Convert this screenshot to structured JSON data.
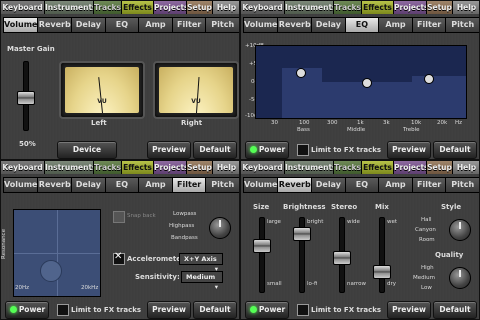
{
  "nav_tabs": [
    "Keyboard",
    "Instruments",
    "Tracks",
    "Effects",
    "Projects",
    "Setup",
    "Help"
  ],
  "panels": {
    "volume": {
      "fx_tabs": [
        "Volume",
        "Reverb",
        "Delay",
        "EQ",
        "Amp",
        "Filter",
        "Pitch"
      ],
      "active": "Volume",
      "master_gain_label": "Master Gain",
      "gain_value": "50%",
      "meter_text": "VU",
      "meter_left": "Left",
      "meter_right": "Right",
      "device_volume": "Device Volume",
      "preview": "Preview",
      "default": "Default"
    },
    "eq": {
      "fx_tabs": [
        "Volume",
        "Reverb",
        "Delay",
        "EQ",
        "Amp",
        "Filter",
        "Pitch"
      ],
      "active": "EQ",
      "db_labels": [
        "+10dB",
        "+5dB",
        "0dB",
        "-5dB",
        "-10dB"
      ],
      "freq_labels": [
        "30",
        "100",
        "300",
        "1k",
        "3k",
        "10k",
        "20k",
        "Hz"
      ],
      "band_labels": [
        "Bass",
        "Middle",
        "Treble"
      ],
      "power": "Power",
      "limit": "Limit to FX tracks",
      "preview": "Preview",
      "default": "Default"
    },
    "filter": {
      "fx_tabs": [
        "Volume",
        "Reverb",
        "Delay",
        "EQ",
        "Amp",
        "Filter",
        "Pitch"
      ],
      "active": "Filter",
      "resonance_label": "Resonance",
      "x_min": "20Hz",
      "x_max": "20kHz",
      "snap_back": "Snap back",
      "modes": [
        "Lowpass",
        "Highpass",
        "Bandpass"
      ],
      "accelerometer": "Accelerometer:",
      "accel_value": "X+Y Axis",
      "sensitivity": "Sensitivity:",
      "sensitivity_value": "Medium",
      "power": "Power",
      "limit": "Limit to FX tracks",
      "preview": "Preview",
      "default": "Default"
    },
    "reverb": {
      "fx_tabs": [
        "Volume",
        "Reverb",
        "Delay",
        "EQ",
        "Amp",
        "Filter",
        "Pitch"
      ],
      "active": "Reverb",
      "size": "Size",
      "brightness": "Brightness",
      "stereo": "Stereo",
      "mix": "Mix",
      "style": "Style",
      "styles": [
        "Hall",
        "Canyon",
        "Room"
      ],
      "quality": "Quality",
      "qualities": [
        "High",
        "Medium",
        "Low"
      ],
      "fader_labels": [
        "large",
        "small",
        "bright",
        "lo-fi",
        "wide",
        "narrow",
        "wet",
        "dry"
      ],
      "power": "Power",
      "limit": "Limit to FX tracks",
      "preview": "Preview",
      "default": "Default"
    }
  }
}
